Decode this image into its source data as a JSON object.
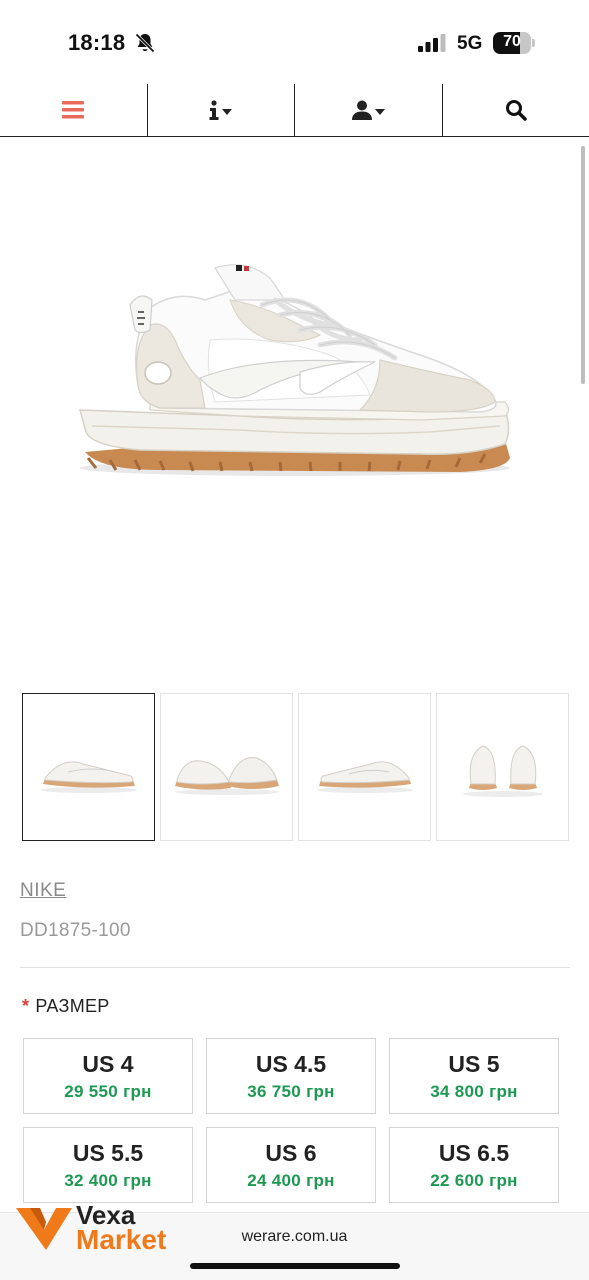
{
  "status_bar": {
    "time": "18:18",
    "network": "5G",
    "battery_percent": 70,
    "battery_label": "70",
    "icons": [
      "bell-slash-icon",
      "signal-icon",
      "battery-icon"
    ]
  },
  "nav": {
    "items": [
      {
        "name": "menu",
        "icon": "hamburger-icon",
        "color": "#e86a5a"
      },
      {
        "name": "info",
        "icon": "info-icon",
        "dropdown": true
      },
      {
        "name": "account",
        "icon": "user-icon",
        "dropdown": true
      },
      {
        "name": "search",
        "icon": "search-icon"
      }
    ]
  },
  "product": {
    "brand": "NIKE",
    "sku": "DD1875-100",
    "thumbnails_count": 4,
    "active_thumbnail": 1
  },
  "sizes": {
    "heading": "РАЗМЕР",
    "required_mark": "*",
    "options": [
      {
        "label": "US 4",
        "price": "29 550 грн"
      },
      {
        "label": "US 4.5",
        "price": "36 750 грн"
      },
      {
        "label": "US 5",
        "price": "34 800 грн"
      },
      {
        "label": "US 5.5",
        "price": "32 400 грн"
      },
      {
        "label": "US 6",
        "price": "24 400 грн"
      },
      {
        "label": "US 6.5",
        "price": "22 600 грн"
      }
    ]
  },
  "browser": {
    "url": "werare.com.ua"
  },
  "watermark": {
    "line1": "Vexa",
    "line2": "Market",
    "accent_color": "#f07a1a"
  }
}
